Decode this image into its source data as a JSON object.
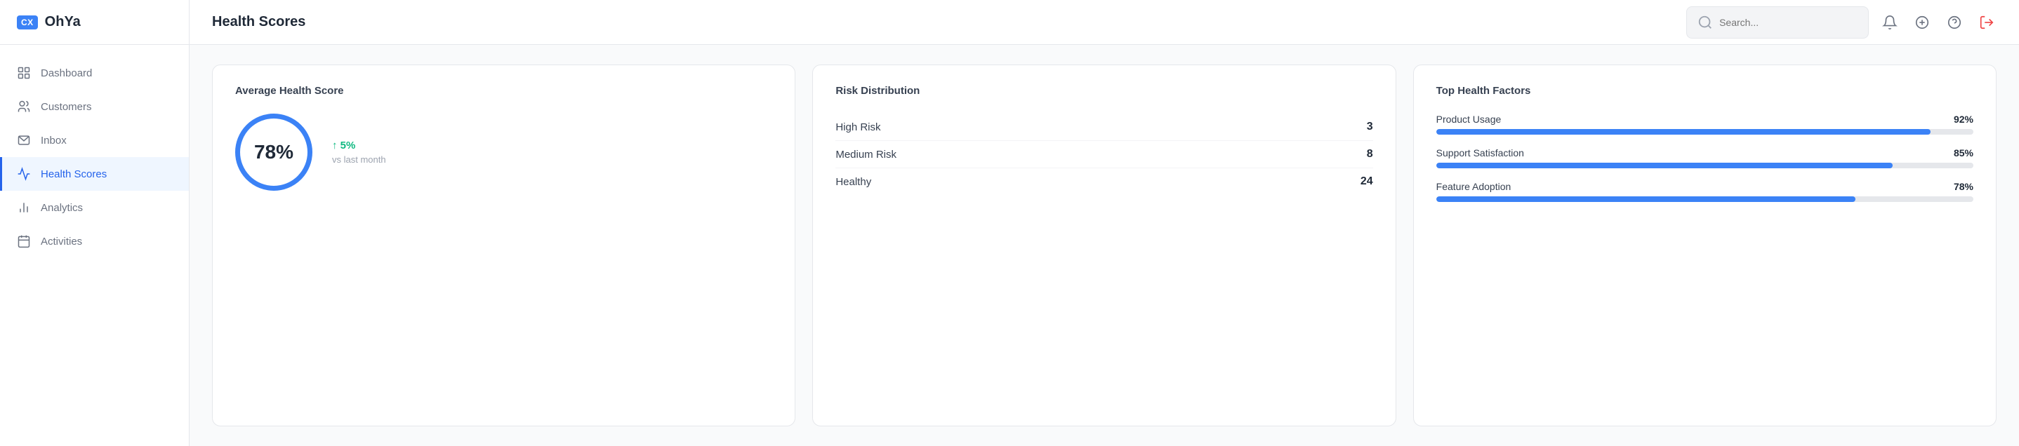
{
  "app": {
    "logo_badge": "CX",
    "logo_name": "OhYa"
  },
  "sidebar": {
    "items": [
      {
        "id": "dashboard",
        "label": "Dashboard",
        "icon": "dashboard-icon",
        "active": false
      },
      {
        "id": "customers",
        "label": "Customers",
        "icon": "customers-icon",
        "active": false
      },
      {
        "id": "inbox",
        "label": "Inbox",
        "icon": "inbox-icon",
        "active": false
      },
      {
        "id": "health-scores",
        "label": "Health Scores",
        "icon": "health-icon",
        "active": true
      },
      {
        "id": "analytics",
        "label": "Analytics",
        "icon": "analytics-icon",
        "active": false
      },
      {
        "id": "activities",
        "label": "Activities",
        "icon": "activities-icon",
        "active": false
      }
    ]
  },
  "topbar": {
    "page_title": "Health Scores",
    "search_placeholder": "Search..."
  },
  "cards": {
    "average_health": {
      "title": "Average Health Score",
      "score": "78%",
      "change": "↑ 5%",
      "vs_label": "vs last month"
    },
    "risk_distribution": {
      "title": "Risk Distribution",
      "rows": [
        {
          "label": "High Risk",
          "count": "3"
        },
        {
          "label": "Medium Risk",
          "count": "8"
        },
        {
          "label": "Healthy",
          "count": "24"
        }
      ]
    },
    "top_factors": {
      "title": "Top Health Factors",
      "items": [
        {
          "name": "Product Usage",
          "pct": "92%",
          "value": 92
        },
        {
          "name": "Support Satisfaction",
          "pct": "85%",
          "value": 85
        },
        {
          "name": "Feature Adoption",
          "pct": "78%",
          "value": 78
        }
      ]
    }
  }
}
